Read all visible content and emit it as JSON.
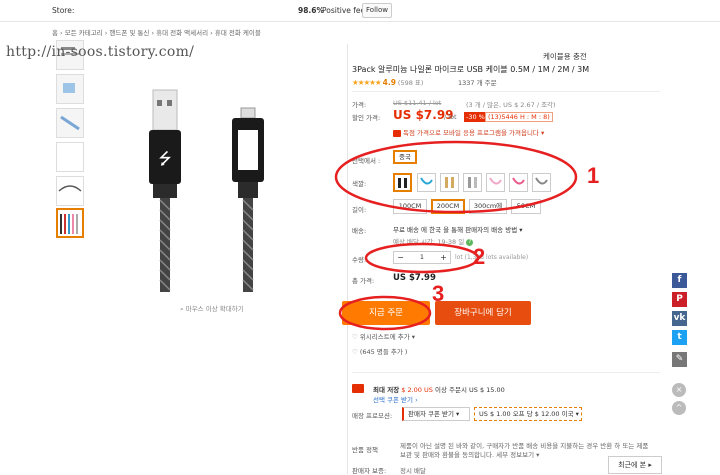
{
  "topbar": {
    "store_label": "Store:",
    "feedback_pct": "98.6%",
    "feedback_label": "Positive feedback",
    "follow_label": "Follow"
  },
  "breadcrumb": "홈 › 모든 카테고리 › 핸드폰 및 통신 › 휴대 전화 액세서리 › 휴대 전화 케이블",
  "watermark": "http://in-soos.tistory.com/",
  "gallery": {
    "zoom_hint": "마우스 이상 확대하기"
  },
  "product": {
    "seller_chip": "케이블용 충전",
    "title": "3Pack 알루미늄 나일론 마이크로 USB 케이블 0.5M / 1M / 2M / 3M",
    "stars": "★★★★★",
    "rating": "4.9",
    "rating_count": "(598 표)",
    "orders": "1337 개 주문"
  },
  "price": {
    "price_label": "가격:",
    "old_price": "US $11.41 / lot",
    "old_price_note": "(3 개 / 많은, US $ 2.67 / 조각)",
    "discount_label": "할인 가격:",
    "new_price": "US $7.99",
    "lot": "/ lot",
    "discount_badge": "-30 %",
    "timer": "(13)5446 H : M : 8)",
    "promo_text": "독점 가격으로 모바일 응용 프로그램을 가져옵니다 ▾"
  },
  "options": {
    "ship_from_label": "선택에서 :",
    "ship_from_value": "중국",
    "color_label": "색깔:",
    "length_label": "길이:",
    "lengths": [
      "100CM",
      "200CM",
      "300cm에",
      "50CM"
    ],
    "shipping_label": "배송:",
    "shipping_text": "무료 배송 에 한국 을 통해 판매자의 배송 방법 ▾",
    "shipping_eta": "예상 배달 시간: 19-38 일",
    "qty_label": "수량:",
    "qty_value": "1",
    "qty_minus": "−",
    "qty_plus": "+",
    "qty_avail": "lot (1,343 lots available)",
    "total_label": "총 가격:",
    "total_value": "US $7.99"
  },
  "actions": {
    "buy_now": "지금 주문",
    "add_to_cart": "장바구니에 담기",
    "wishlist": "위시리스트에 추가 ▾",
    "wish_count": "(645 명들 추가 )"
  },
  "coupon": {
    "title_prefix": "최대 저장",
    "amount": "$ 2.00 US",
    "title_suffix": "이상 주문시 US $ 15.00",
    "link": "선택 쿠폰 받기 ›"
  },
  "store_promo": {
    "label": "매장 프로모션:",
    "opt1": "판매자 쿠폰 받기 ▾",
    "opt2": "US $ 1.00 오프 당 $ 12.00 이국 ▾"
  },
  "returns": {
    "label": "반품 정책",
    "text": "제품이 아닌 설명 된 바와 같이, 구매자가 반품 배송 비용을 지불하는 경우 반환 하 또는 제품 보관 및 판매와 환불을 동의합니다. 세부 정보보기 ▾"
  },
  "guarantee": {
    "label": "판매자 보증:",
    "text": "정시 배달"
  },
  "recent": "최근에 본 ▸",
  "annotations": {
    "n1": "1",
    "n2": "2",
    "n3": "3"
  },
  "colors": {
    "accent": "#ff7a00",
    "price_red": "#e62e04",
    "cart_red": "#e64d0e",
    "annotation_red": "#e62020"
  },
  "social": [
    "facebook-icon",
    "pinterest-icon",
    "vk-icon",
    "twitter-icon",
    "edit-icon"
  ]
}
